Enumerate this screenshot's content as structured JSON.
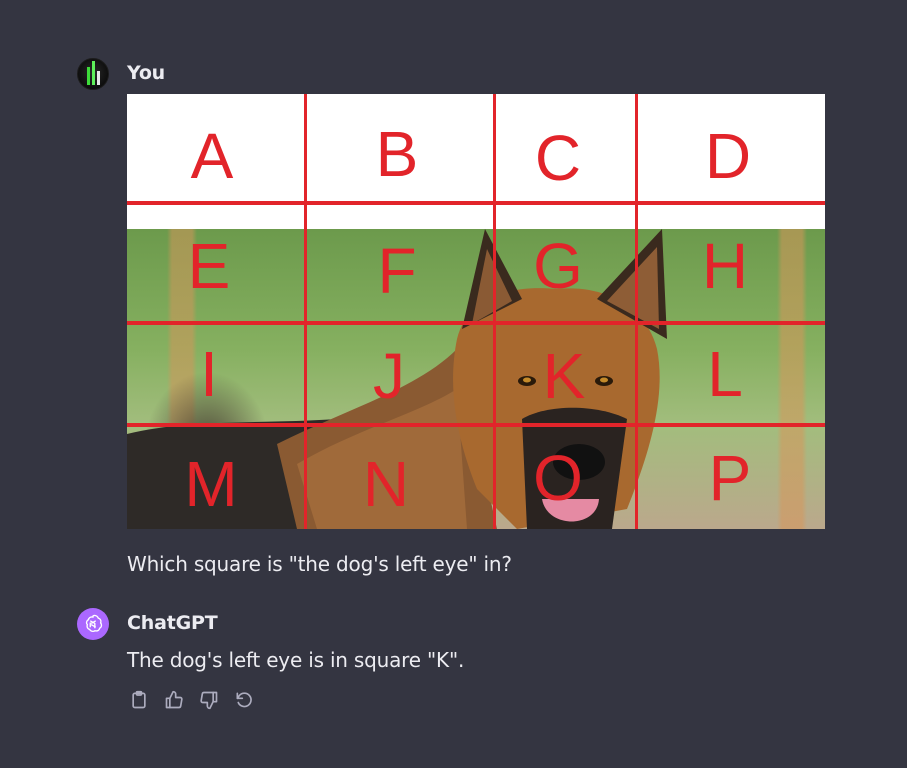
{
  "user_message": {
    "author": "You",
    "image_grid": {
      "row1": [
        "A",
        "B",
        "C",
        "D"
      ],
      "row2": [
        "E",
        "F",
        "G",
        "H"
      ],
      "row3": [
        "I",
        "J",
        "K",
        "L"
      ],
      "row4": [
        "M",
        "N",
        "O",
        "P"
      ]
    },
    "text": "Which square is \"the dog's left eye\" in?"
  },
  "assistant_message": {
    "author": "ChatGPT",
    "text": "The dog's left eye is in square \"K\".",
    "actions": {
      "copy_icon": "clipboard-icon",
      "like_icon": "thumbs-up-icon",
      "dislike_icon": "thumbs-down-icon",
      "regenerate_icon": "regenerate-icon"
    }
  },
  "colors": {
    "background": "#343541",
    "text": "#ececf1",
    "grid_red": "#e2242a",
    "assistant_avatar": "#ab68ff",
    "action_icon": "#acacbe"
  }
}
